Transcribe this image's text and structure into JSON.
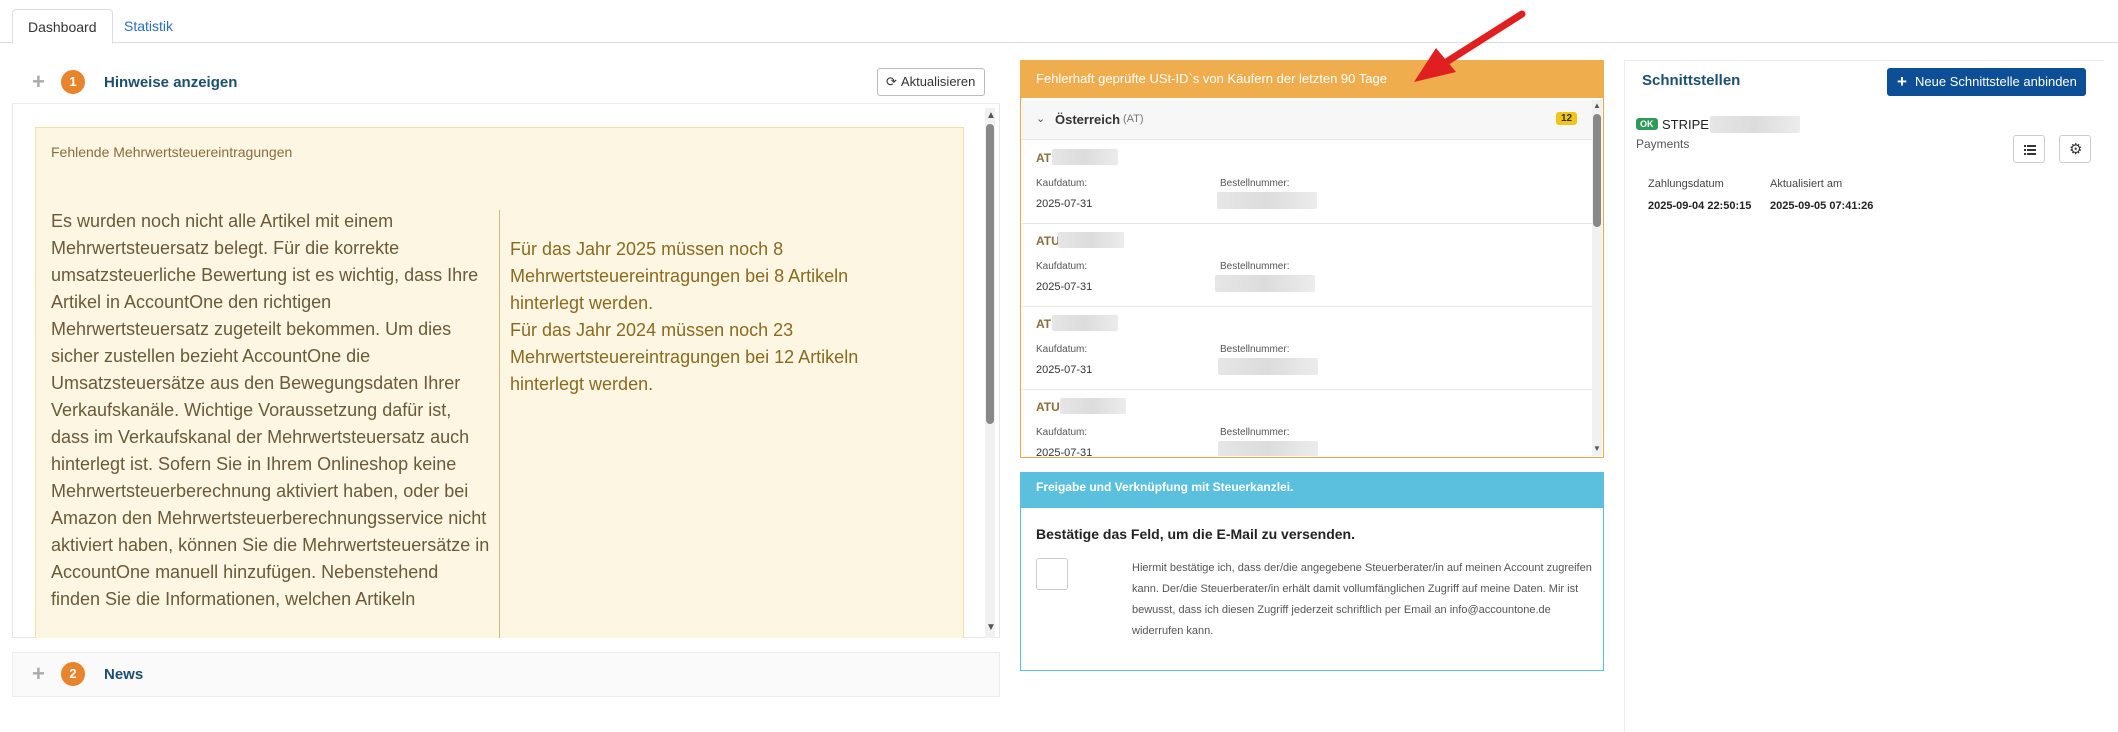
{
  "tabs": [
    {
      "label": "Dashboard",
      "active": true
    },
    {
      "label": "Statistik",
      "active": false
    }
  ],
  "hints_panel": {
    "number": "1",
    "title": "Hinweise anzeigen",
    "refresh_label": "Aktualisieren",
    "notice_title": "Fehlende Mehrwertsteuereintragungen",
    "notice_text": "Es wurden noch nicht alle Artikel mit einem Mehrwertsteuersatz belegt. Für die korrekte umsatzsteuerliche Bewertung ist es wichtig, dass Ihre Artikel in AccountOne den richtigen Mehrwertsteuersatz zugeteilt bekommen. Um dies sicher zustellen bezieht AccountOne die Umsatzsteuersätze aus den Bewegungsdaten Ihrer Verkaufskanäle. Wichtige Voraussetzung dafür ist, dass im Verkaufskanal der Mehrwertsteuersatz auch hinterlegt ist. Sofern Sie in Ihrem Onlineshop keine Mehrwertsteuerberechnung aktiviert haben, oder bei Amazon den Mehrwertsteuerberechnungsservice nicht aktiviert haben, können Sie die Mehrwertsteuersätze in AccountOne manuell hinzufügen. Nebenstehend finden Sie die Informationen, welchen Artikeln",
    "notice_right_1": "Für das Jahr 2025 müssen noch 8 Mehrwertsteuereintragungen bei 8 Artikeln hinterlegt werden.",
    "notice_right_2": "Für das Jahr 2024 müssen noch 23 Mehrwertsteuereintragungen bei 12 Artikeln hinterlegt werden."
  },
  "news_panel": {
    "number": "2",
    "title": "News"
  },
  "ust_panel": {
    "header": "Fehlerhaft geprüfte USt-ID`s von Käufern der letzten 90 Tage",
    "group_name": "Österreich",
    "group_code": "(AT)",
    "group_count": "12",
    "label_date": "Kaufdatum:",
    "label_order": "Bestellnummer:",
    "items": [
      {
        "prefix": "AT",
        "date": "2025-07-31"
      },
      {
        "prefix": "ATU",
        "date": "2025-07-31"
      },
      {
        "prefix": "AT",
        "date": "2025-07-31"
      },
      {
        "prefix": "ATU",
        "date": "2025-07-31"
      }
    ]
  },
  "tax_panel": {
    "header": "Freigabe und Verknüpfung mit Steuerkanzlei.",
    "confirm_title": "Bestätige das Feld, um die E-Mail zu versenden.",
    "confirm_text": "Hiermit bestätige ich, dass der/die angegebene Steuerberater/in auf meinen Account zugreifen kann. Der/die Steuerberater/in erhält damit vollumfänglichen Zugriff auf meine Daten. Mir ist bewusst, dass ich diesen Zugriff jederzeit schriftlich per Email an info@accountone.de widerrufen kann."
  },
  "interfaces": {
    "title": "Schnittstellen",
    "new_button": "Neue Schnittstelle anbinden",
    "status": "OK",
    "name": "STRIPE",
    "type": "Payments",
    "col_payment_date": "Zahlungsdatum",
    "col_updated": "Aktualisiert am",
    "payment_date": "2025-09-04 22:50:15",
    "updated": "2025-09-05 07:41:26"
  },
  "colors": {
    "warning_header": "#f0ad4e",
    "info_header": "#5bc0de",
    "primary_button": "#0d4f96",
    "annotation_arrow": "#e02020"
  }
}
